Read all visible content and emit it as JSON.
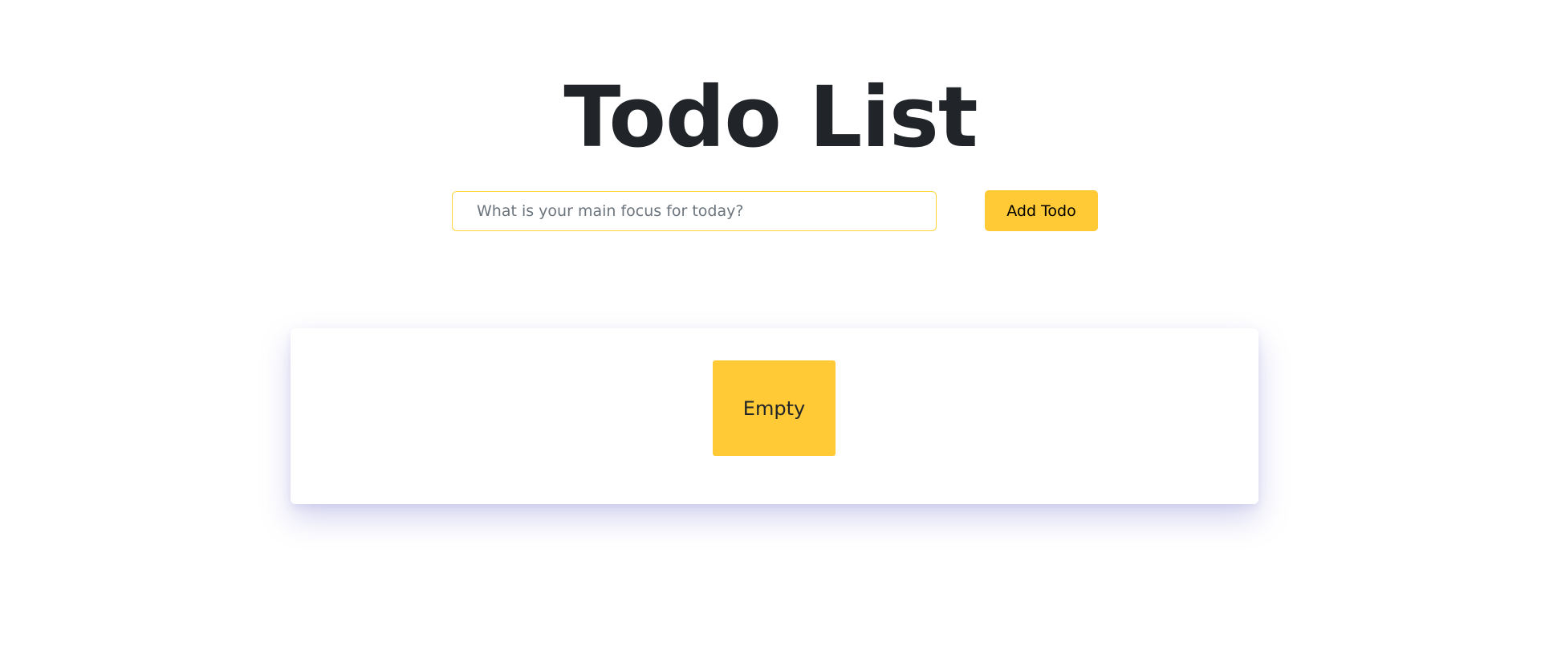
{
  "header": {
    "title": "Todo List"
  },
  "form": {
    "input_value": "",
    "input_placeholder": "What is your main focus for today?",
    "add_button_label": "Add Todo"
  },
  "list": {
    "empty_label": "Empty",
    "items": []
  },
  "colors": {
    "accent": "#ffca36",
    "input_border": "#ffd43b",
    "text": "#212529",
    "background": "#ffffff",
    "card_shadow": "#6c68c8"
  }
}
